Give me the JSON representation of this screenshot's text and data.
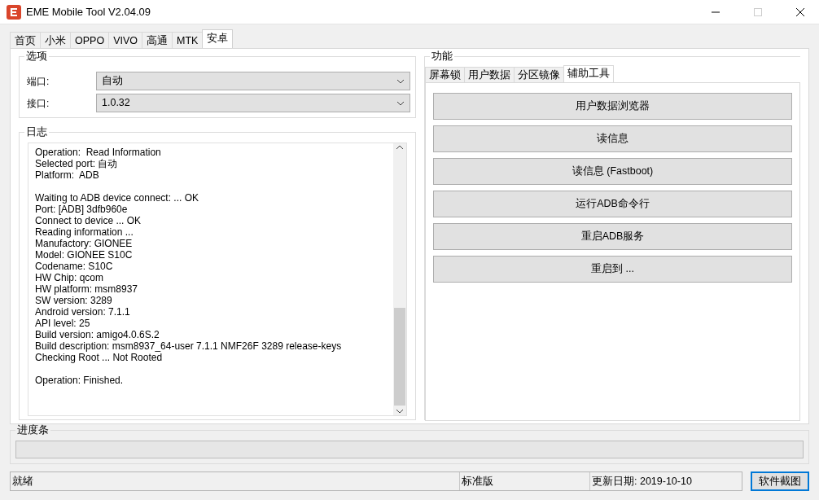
{
  "window": {
    "title": "EME Mobile Tool V2.04.09"
  },
  "tabs": [
    {
      "label": "首页",
      "selected": false
    },
    {
      "label": "小米",
      "selected": false
    },
    {
      "label": "OPPO",
      "selected": false
    },
    {
      "label": "VIVO",
      "selected": false
    },
    {
      "label": "高通",
      "selected": false
    },
    {
      "label": "MTK",
      "selected": false
    },
    {
      "label": "安卓",
      "selected": true
    }
  ],
  "options": {
    "title": "选项",
    "fields": [
      {
        "label": "端口:",
        "value": "自动"
      },
      {
        "label": "接口:",
        "value": "1.0.32"
      }
    ]
  },
  "log": {
    "title": "日志",
    "blocks": [
      [
        "Operation:  Read Information",
        "Selected port: 自动",
        "Platform:  ADB"
      ],
      [
        "Waiting to ADB device connect: ... OK",
        "Port: [ADB] 3dfb960e",
        "Connect to device ... OK",
        "Reading information ...",
        "Manufactory: GIONEE",
        "Model: GIONEE S10C",
        "Codename: S10C",
        "HW Chip: qcom",
        "HW platform: msm8937",
        "SW version: 3289",
        "Android version: 7.1.1",
        "API level: 25",
        "Build version: amigo4.0.6S.2",
        "Build description: msm8937_64-user 7.1.1 NMF26F 3289 release-keys",
        "Checking Root ... Not Rooted"
      ],
      [
        "Operation: Finished."
      ]
    ]
  },
  "functions": {
    "title": "功能",
    "tabs": [
      {
        "label": "屏幕锁",
        "selected": false
      },
      {
        "label": "用户数据",
        "selected": false
      },
      {
        "label": "分区镜像",
        "selected": false
      },
      {
        "label": "辅助工具",
        "selected": true
      }
    ],
    "buttons": [
      "用户数据浏览器",
      "读信息",
      "读信息 (Fastboot)",
      "运行ADB命令行",
      "重启ADB服务",
      "重启到 ..."
    ]
  },
  "progress": {
    "title": "进度条",
    "level": 0
  },
  "status_bar": {
    "status": "就绪",
    "edition": "标准版",
    "updated": "更新日期:  2019-10-10",
    "button": "软件截图"
  }
}
